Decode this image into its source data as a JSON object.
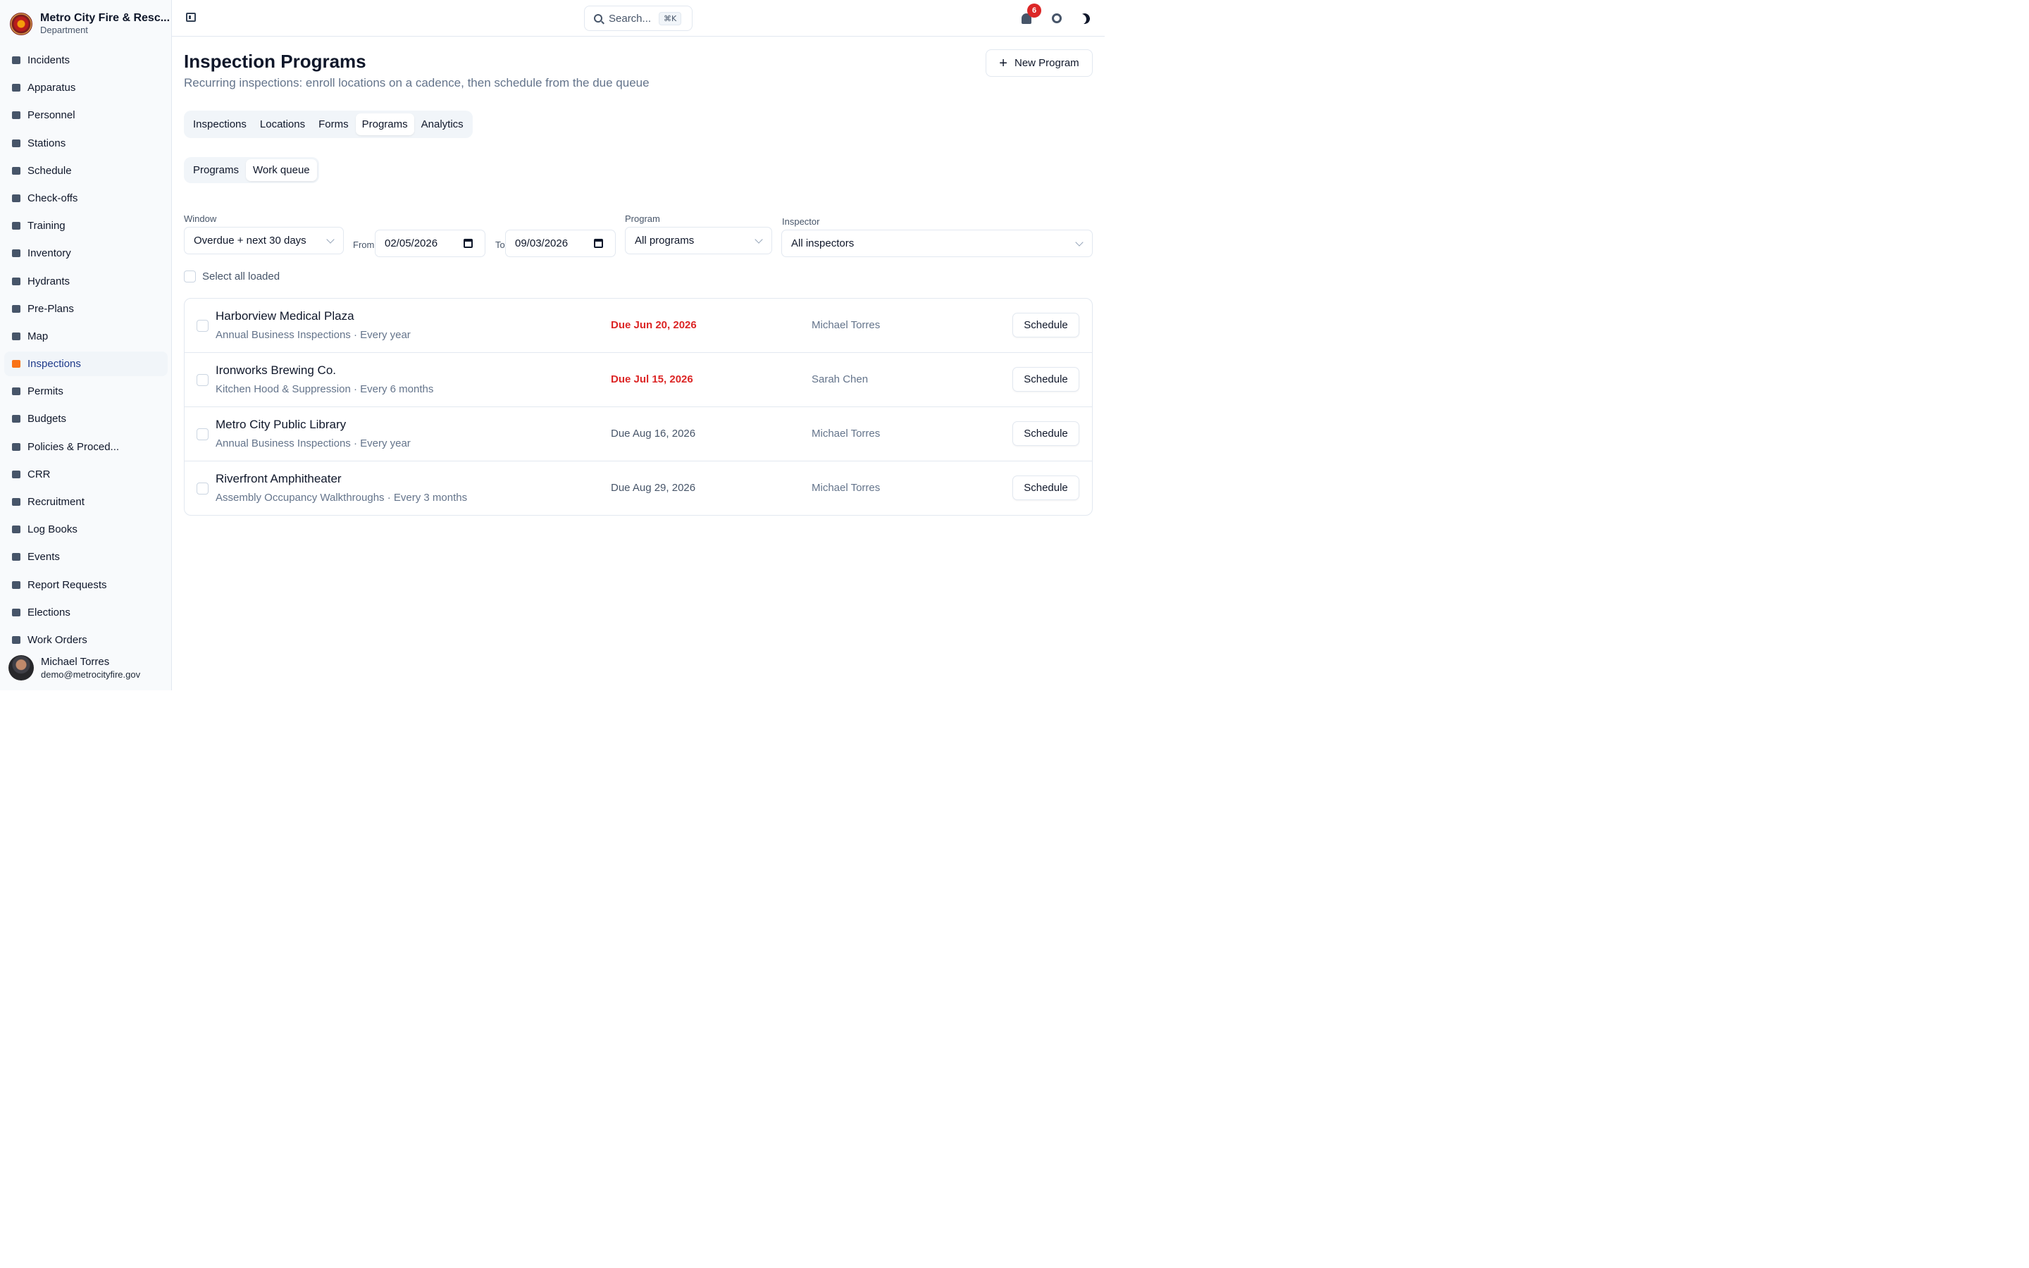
{
  "brand": {
    "name": "Metro City Fire & Resc...",
    "sub": "Department"
  },
  "nav": [
    {
      "label": "Incidents",
      "icon": "incidents-icon"
    },
    {
      "label": "Apparatus",
      "icon": "apparatus-icon"
    },
    {
      "label": "Personnel",
      "icon": "personnel-icon"
    },
    {
      "label": "Stations",
      "icon": "stations-icon"
    },
    {
      "label": "Schedule",
      "icon": "schedule-icon"
    },
    {
      "label": "Check-offs",
      "icon": "check-offs-icon"
    },
    {
      "label": "Training",
      "icon": "training-icon"
    },
    {
      "label": "Inventory",
      "icon": "inventory-icon"
    },
    {
      "label": "Hydrants",
      "icon": "hydrants-icon"
    },
    {
      "label": "Pre-Plans",
      "icon": "pre-plans-icon"
    },
    {
      "label": "Map",
      "icon": "map-icon"
    },
    {
      "label": "Inspections",
      "icon": "inspections-icon",
      "active": true
    },
    {
      "label": "Permits",
      "icon": "permits-icon"
    },
    {
      "label": "Budgets",
      "icon": "budgets-icon"
    },
    {
      "label": "Policies & Proced...",
      "icon": "policies-icon"
    },
    {
      "label": "CRR",
      "icon": "megaphone-icon"
    },
    {
      "label": "Recruitment",
      "icon": "handshake-icon"
    },
    {
      "label": "Log Books",
      "icon": "log-books-icon"
    },
    {
      "label": "Events",
      "icon": "events-icon"
    },
    {
      "label": "Report Requests",
      "icon": "report-requests-icon"
    },
    {
      "label": "Elections",
      "icon": "ballot-icon"
    },
    {
      "label": "Work Orders",
      "icon": "wrench-icon"
    }
  ],
  "user": {
    "name": "Michael Torres",
    "email": "demo@metrocityfire.gov"
  },
  "topbar": {
    "search_placeholder": "Search...",
    "shortcut": "⌘K",
    "notification_count": "6"
  },
  "page": {
    "title": "Inspection Programs",
    "subtitle": "Recurring inspections: enroll locations on a cadence, then schedule from the due queue",
    "new_button": "New Program"
  },
  "tabs": [
    "Inspections",
    "Locations",
    "Forms",
    "Programs",
    "Analytics"
  ],
  "active_tab": "Programs",
  "subtabs": [
    "Programs",
    "Work queue"
  ],
  "active_subtab": "Work queue",
  "filters": {
    "window_label": "Window",
    "window_value": "Overdue + next 30 days",
    "from_label": "From",
    "from_value": "02/05/2026",
    "to_label": "To",
    "to_value": "09/03/2026",
    "program_label": "Program",
    "program_value": "All programs",
    "inspector_label": "Inspector",
    "inspector_value": "All inspectors"
  },
  "select_all_label": "Select all loaded",
  "rows": [
    {
      "name": "Harborview Medical Plaza",
      "meta": "Annual Business Inspections · Every year",
      "due": "Due Jun 20, 2026",
      "overdue": true,
      "inspector": "Michael Torres",
      "action": "Schedule"
    },
    {
      "name": "Ironworks Brewing Co.",
      "meta": "Kitchen Hood & Suppression · Every 6 months",
      "due": "Due Jul 15, 2026",
      "overdue": true,
      "inspector": "Sarah Chen",
      "action": "Schedule"
    },
    {
      "name": "Metro City Public Library",
      "meta": "Annual Business Inspections · Every year",
      "due": "Due Aug 16, 2026",
      "overdue": false,
      "inspector": "Michael Torres",
      "action": "Schedule"
    },
    {
      "name": "Riverfront Amphitheater",
      "meta": "Assembly Occupancy Walkthroughs · Every 3 months",
      "due": "Due Aug 29, 2026",
      "overdue": false,
      "inspector": "Michael Torres",
      "action": "Schedule"
    }
  ],
  "colors": {
    "overdue": "#dc2626",
    "active_nav_icon": "#f97316",
    "badge": "#dc2626"
  }
}
